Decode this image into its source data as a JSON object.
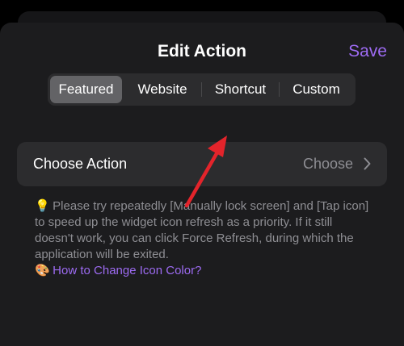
{
  "header": {
    "title": "Edit Action",
    "save_label": "Save"
  },
  "tabs": [
    {
      "label": "Featured",
      "selected": true
    },
    {
      "label": "Website",
      "selected": false
    },
    {
      "label": "Shortcut",
      "selected": false
    },
    {
      "label": "Custom",
      "selected": false
    }
  ],
  "action_row": {
    "label": "Choose Action",
    "value": "Choose",
    "icon": "chevron-right-icon"
  },
  "hint": {
    "emoji": "💡",
    "text": "Please try repeatedly [Manually lock screen] and [Tap icon] to speed up the widget icon refresh as a priority. If it still doesn't work, you can click Force Refresh, during which the application will be exited."
  },
  "link": {
    "emoji": "🎨",
    "text": "How to Change Icon Color?"
  },
  "colors": {
    "accent": "#9d6bf2",
    "background": "#1c1c1e",
    "control": "#2c2c2e",
    "selected_segment": "#636366",
    "secondary_text": "#8e8e93",
    "annotation_arrow": "#e3242b"
  }
}
